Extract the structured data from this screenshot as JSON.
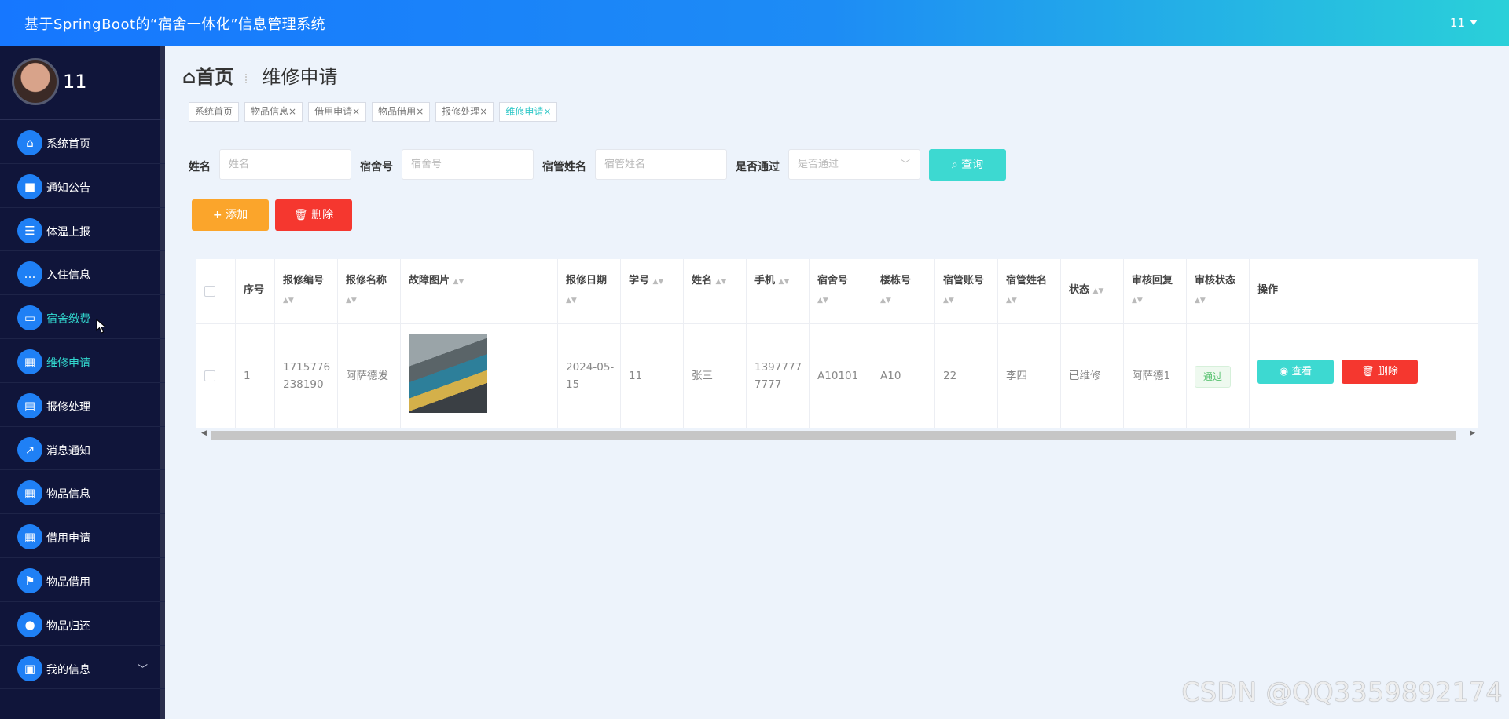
{
  "app": {
    "title": "基于SpringBoot的“宿舍一体化”信息管理系统",
    "user_name": "11"
  },
  "sidebar": {
    "username": "11",
    "items": [
      {
        "label": "系统首页",
        "icon": "home-icon"
      },
      {
        "label": "通知公告",
        "icon": "briefcase-icon"
      },
      {
        "label": "体温上报",
        "icon": "list-icon"
      },
      {
        "label": "入住信息",
        "icon": "chat-icon"
      },
      {
        "label": "宿舍缴费",
        "icon": "monitor-icon"
      },
      {
        "label": "维修申请",
        "icon": "grid-icon"
      },
      {
        "label": "报修处理",
        "icon": "clipboard-icon"
      },
      {
        "label": "消息通知",
        "icon": "chart-icon"
      },
      {
        "label": "物品信息",
        "icon": "grid-icon"
      },
      {
        "label": "借用申请",
        "icon": "grid-icon"
      },
      {
        "label": "物品借用",
        "icon": "flag-icon"
      },
      {
        "label": "物品归还",
        "icon": "user-icon"
      },
      {
        "label": "我的信息",
        "icon": "card-icon"
      }
    ]
  },
  "breadcrumb": {
    "home": "首页",
    "current": "维修申请"
  },
  "tabs": [
    {
      "label": "系统首页",
      "closable": false
    },
    {
      "label": "物品信息",
      "closable": true
    },
    {
      "label": "借用申请",
      "closable": true
    },
    {
      "label": "物品借用",
      "closable": true
    },
    {
      "label": "报修处理",
      "closable": true
    },
    {
      "label": "维修申请",
      "closable": true
    }
  ],
  "search": {
    "name_label": "姓名",
    "name_placeholder": "姓名",
    "room_label": "宿舍号",
    "room_placeholder": "宿舍号",
    "manager_label": "宿管姓名",
    "manager_placeholder": "宿管姓名",
    "pass_label": "是否通过",
    "pass_placeholder": "是否通过",
    "search_button": "查询"
  },
  "actions": {
    "add": "添加",
    "delete": "删除"
  },
  "table": {
    "headers": [
      "序号",
      "报修编号",
      "报修名称",
      "故障图片",
      "报修日期",
      "学号",
      "姓名",
      "手机",
      "宿舍号",
      "楼栋号",
      "宿管账号",
      "宿管姓名",
      "状态",
      "审核回复",
      "审核状态",
      "操作"
    ],
    "rows": [
      {
        "index": "1",
        "repair_no": "1715776238190",
        "repair_name": "阿萨德发",
        "date": "2024-05-15",
        "student_no": "11",
        "name": "张三",
        "phone": "13977777777",
        "room": "A10101",
        "building": "A10",
        "manager_account": "22",
        "manager_name": "李四",
        "status": "已维修",
        "reply": "阿萨德1",
        "audit_status": "通过",
        "view_label": "查看",
        "delete_label": "删除"
      }
    ]
  },
  "watermark": "CSDN @QQ3359892174",
  "colors": {
    "primary": "#1677ff",
    "cyan": "#3dd9d1",
    "orange": "#fba52b",
    "red": "#f5372f",
    "sidebar": "#10153a"
  }
}
